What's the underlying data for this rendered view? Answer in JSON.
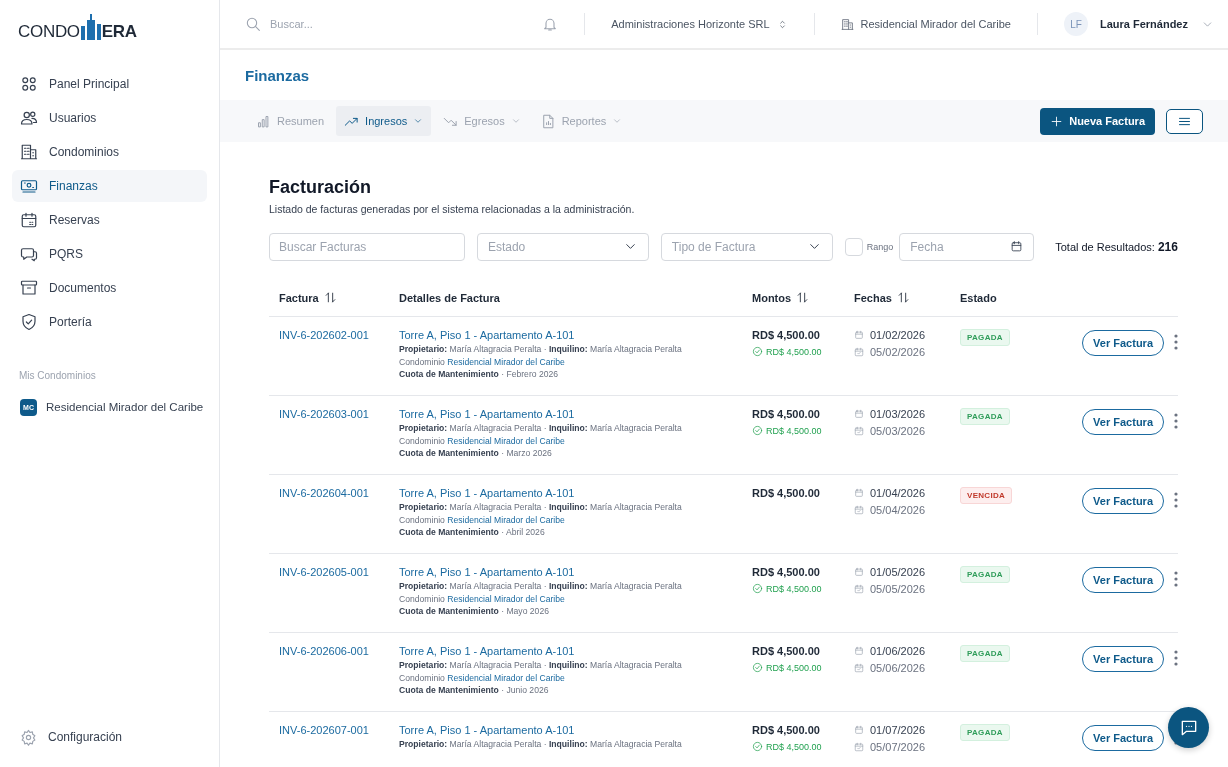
{
  "sidebar": {
    "logo": {
      "left": "CONDO",
      "right": "ERA"
    },
    "nav": [
      {
        "label": "Panel Principal",
        "selected": false
      },
      {
        "label": "Usuarios",
        "selected": false
      },
      {
        "label": "Condominios",
        "selected": false
      },
      {
        "label": "Finanzas",
        "selected": true
      },
      {
        "label": "Reservas",
        "selected": false
      },
      {
        "label": "PQRS",
        "selected": false
      },
      {
        "label": "Documentos",
        "selected": false
      },
      {
        "label": "Portería",
        "selected": false
      }
    ],
    "section_label": "Mis Condominios",
    "condos": [
      {
        "initials": "MC",
        "name": "Residencial Mirador del Caribe"
      }
    ],
    "footer": {
      "label": "Configuración"
    }
  },
  "topbar": {
    "search": {
      "placeholder": "Buscar..."
    },
    "organization": "Administraciones Horizonte SRL",
    "condominium": "Residencial Mirador del Caribe",
    "user": {
      "initials": "LF",
      "name": "Laura Fernández"
    }
  },
  "page": {
    "title": "Finanzas",
    "tabs": [
      {
        "label": "Resumen",
        "dropdown": false,
        "selected": false
      },
      {
        "label": "Ingresos",
        "dropdown": true,
        "selected": true
      },
      {
        "label": "Egresos",
        "dropdown": true,
        "selected": false
      },
      {
        "label": "Reportes",
        "dropdown": true,
        "selected": false
      }
    ],
    "primary_button": "Nueva Factura"
  },
  "billing": {
    "title": "Facturación",
    "subtitle": "Listado de facturas generadas por el sistema relacionadas a la administración.",
    "filters": {
      "search": {
        "placeholder": "Buscar Facturas"
      },
      "status": {
        "placeholder": "Estado"
      },
      "type": {
        "placeholder": "Tipo de Factura"
      },
      "range": {
        "label": "Rango",
        "checked": false
      },
      "date": {
        "placeholder": "Fecha"
      }
    },
    "total_label": "Total de Resultados:",
    "total": "216",
    "columns": [
      {
        "label": "Factura",
        "sortable": true
      },
      {
        "label": "Detalles de Factura",
        "sortable": false
      },
      {
        "label": "Montos",
        "sortable": true
      },
      {
        "label": "Fechas",
        "sortable": true
      },
      {
        "label": "Estado",
        "sortable": false
      }
    ],
    "rows": [
      {
        "invoice": "INV-6-202602-001",
        "unit": "Torre A, Piso 1 - Apartamento A-101",
        "people": "**Propietario:** María Altagracia Peralta · **Inquilino:** María Altagracia Peralta",
        "condo_label": "Condominio",
        "condo": "Residencial Mirador del Caribe",
        "concept": "**Cuota de Mantenimiento** · Febrero 2026",
        "amount": "RD$ 4,500.00",
        "paid": "RD$ 4,500.00",
        "issued": "01/02/2026",
        "due": "05/02/2026",
        "status": {
          "label": "PAGADA",
          "kind": "paid"
        },
        "action": "Ver Factura"
      },
      {
        "invoice": "INV-6-202603-001",
        "unit": "Torre A, Piso 1 - Apartamento A-101",
        "people": "**Propietario:** María Altagracia Peralta · **Inquilino:** María Altagracia Peralta",
        "condo_label": "Condominio",
        "condo": "Residencial Mirador del Caribe",
        "concept": "**Cuota de Mantenimiento** · Marzo 2026",
        "amount": "RD$ 4,500.00",
        "paid": "RD$ 4,500.00",
        "issued": "01/03/2026",
        "due": "05/03/2026",
        "status": {
          "label": "PAGADA",
          "kind": "paid"
        },
        "action": "Ver Factura"
      },
      {
        "invoice": "INV-6-202604-001",
        "unit": "Torre A, Piso 1 - Apartamento A-101",
        "people": "**Propietario:** María Altagracia Peralta · **Inquilino:** María Altagracia Peralta",
        "condo_label": "Condominio",
        "condo": "Residencial Mirador del Caribe",
        "concept": "**Cuota de Mantenimiento** · Abril 2026",
        "amount": "RD$ 4,500.00",
        "issued": "01/04/2026",
        "due": "05/04/2026",
        "status": {
          "label": "VENCIDA",
          "kind": "overdue"
        },
        "action": "Ver Factura"
      },
      {
        "invoice": "INV-6-202605-001",
        "unit": "Torre A, Piso 1 - Apartamento A-101",
        "people": "**Propietario:** María Altagracia Peralta · **Inquilino:** María Altagracia Peralta",
        "condo_label": "Condominio",
        "condo": "Residencial Mirador del Caribe",
        "concept": "**Cuota de Mantenimiento** · Mayo 2026",
        "amount": "RD$ 4,500.00",
        "paid": "RD$ 4,500.00",
        "issued": "01/05/2026",
        "due": "05/05/2026",
        "status": {
          "label": "PAGADA",
          "kind": "paid"
        },
        "action": "Ver Factura"
      },
      {
        "invoice": "INV-6-202606-001",
        "unit": "Torre A, Piso 1 - Apartamento A-101",
        "people": "**Propietario:** María Altagracia Peralta · **Inquilino:** María Altagracia Peralta",
        "condo_label": "Condominio",
        "condo": "Residencial Mirador del Caribe",
        "concept": "**Cuota de Mantenimiento** · Junio 2026",
        "amount": "RD$ 4,500.00",
        "paid": "RD$ 4,500.00",
        "issued": "01/06/2026",
        "due": "05/06/2026",
        "status": {
          "label": "PAGADA",
          "kind": "paid"
        },
        "action": "Ver Factura"
      },
      {
        "invoice": "INV-6-202607-001",
        "unit": "Torre A, Piso 1 - Apartamento A-101",
        "people": "**Propietario:** María Altagracia Peralta · **Inquilino:** María Altagracia Peralta",
        "amount": "RD$ 4,500.00",
        "paid": "RD$ 4,500.00",
        "issued": "01/07/2026",
        "due": "05/07/2026",
        "status": {
          "label": "PAGADA",
          "kind": "paid"
        },
        "action": "Ver Factura"
      }
    ]
  }
}
